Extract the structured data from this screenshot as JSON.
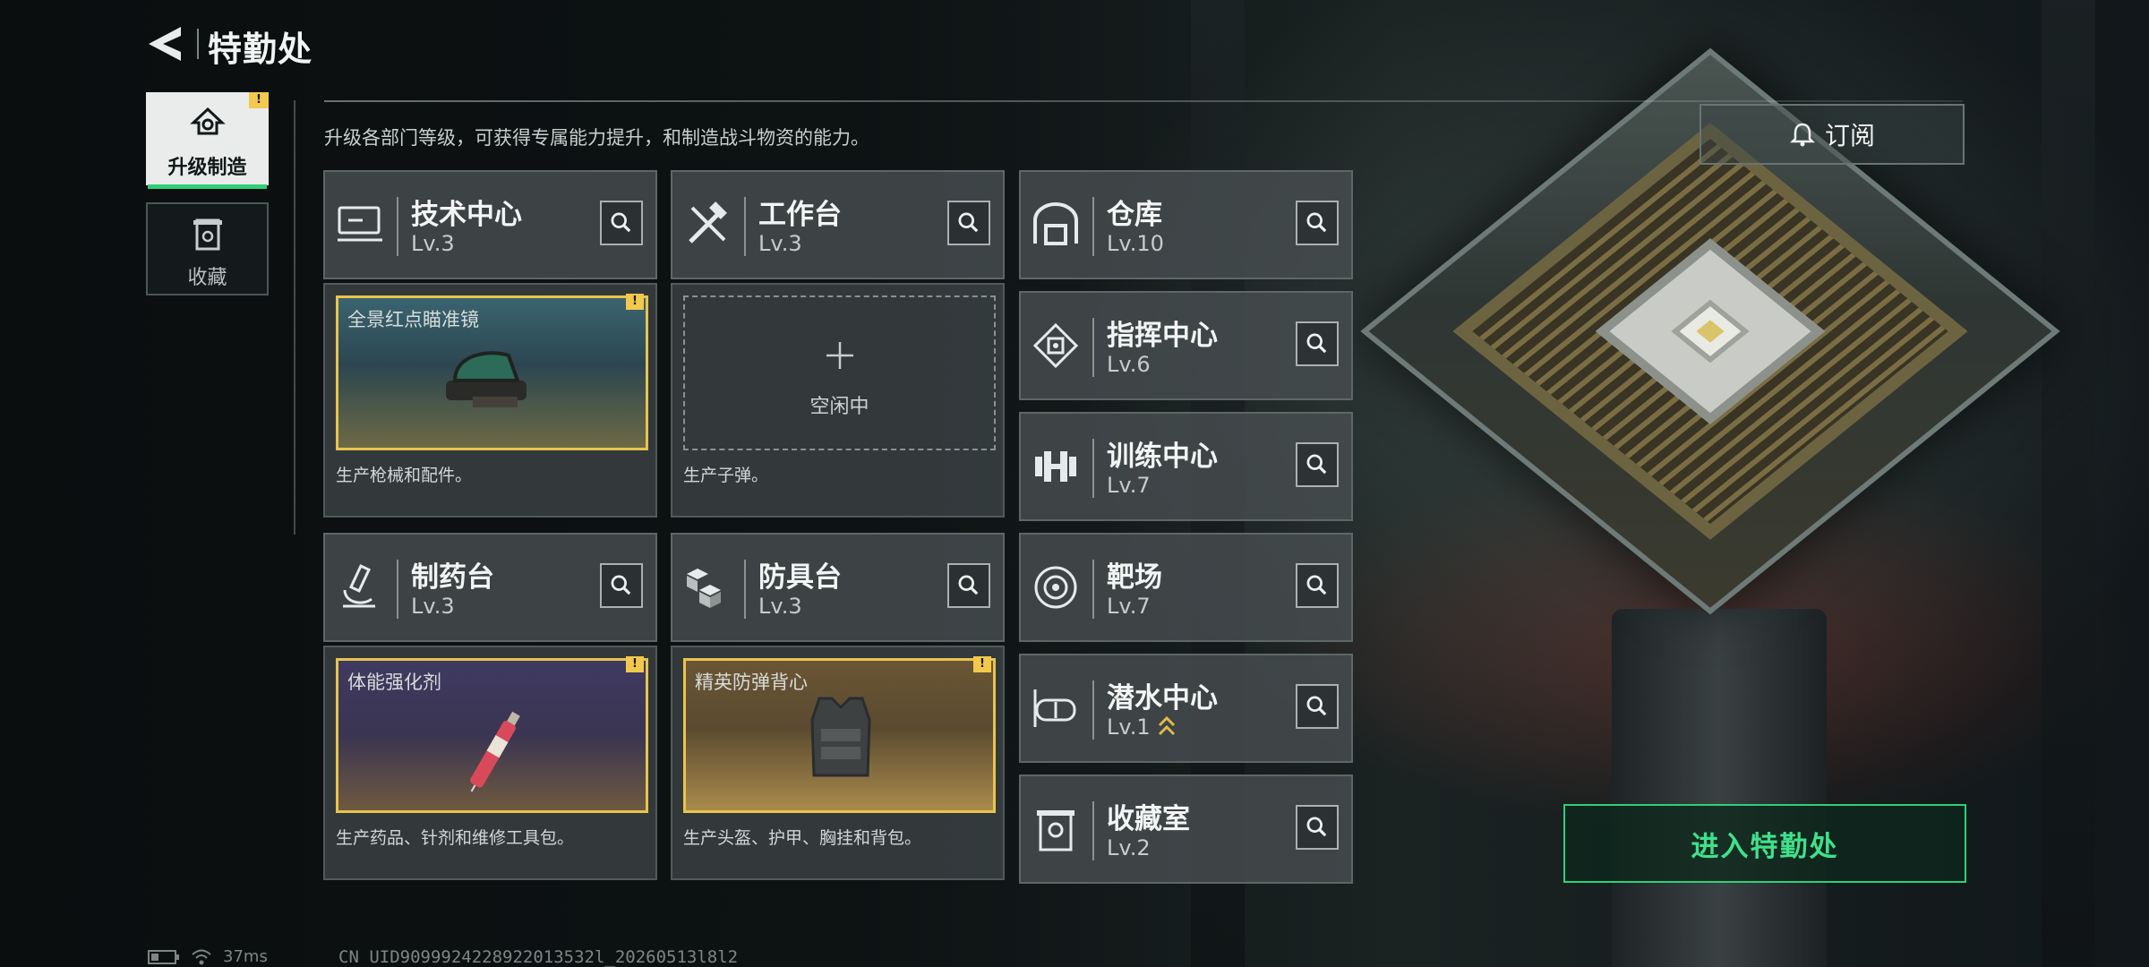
{
  "header": {
    "title": "特勤处"
  },
  "side_tabs": [
    {
      "label": "升级制造",
      "icon": "upgrade-icon",
      "badge": "!"
    },
    {
      "label": "收藏",
      "icon": "collection-icon"
    }
  ],
  "subtitle": "升级各部门等级，可获得专属能力提升，和制造战斗物资的能力。",
  "subscribe": {
    "label": "订阅",
    "icon": "bell-icon"
  },
  "departments": [
    {
      "name": "技术中心",
      "level": "Lv.3",
      "icon": "computer-icon"
    },
    {
      "name": "工作台",
      "level": "Lv.3",
      "icon": "tools-icon"
    },
    {
      "name": "制药台",
      "level": "Lv.3",
      "icon": "microscope-icon"
    },
    {
      "name": "防具台",
      "level": "Lv.3",
      "icon": "blocks-icon"
    },
    {
      "name": "仓库",
      "level": "Lv.10",
      "icon": "warehouse-icon"
    },
    {
      "name": "指挥中心",
      "level": "Lv.6",
      "icon": "chip-icon"
    },
    {
      "name": "训练中心",
      "level": "Lv.7",
      "icon": "dumbbell-icon"
    },
    {
      "name": "靶场",
      "level": "Lv.7",
      "icon": "target-icon"
    },
    {
      "name": "潜水中心",
      "level": "Lv.1",
      "icon": "goggles-icon",
      "upgradable": true
    },
    {
      "name": "收藏室",
      "level": "Lv.2",
      "icon": "trophy-icon"
    }
  ],
  "production": [
    {
      "item": "全景红点瞄准镜",
      "desc": "生产枪械和配件。",
      "badge": "!",
      "image": "scope",
      "tint": "#3a6470"
    },
    {
      "item": "",
      "empty_label": "空闲中",
      "desc": "生产子弹。",
      "image": "empty"
    },
    {
      "item": "体能强化剂",
      "desc": "生产药品、针剂和维修工具包。",
      "badge": "!",
      "image": "syringe",
      "tint": "#3f3a60"
    },
    {
      "item": "精英防弹背心",
      "desc": "生产头盔、护甲、胸挂和背包。",
      "badge": "!",
      "image": "vest",
      "tint": "#6a5634"
    }
  ],
  "enter_button": {
    "label": "进入特勤处",
    "color": "#3fe18b"
  },
  "status_bar": {
    "ping": "37ms",
    "uid": "CN UID9099924228922013532l_20260513l8l2"
  },
  "colors": {
    "accent_green": "#2fcf79",
    "badge_yellow": "#f2c94c",
    "slot_border": "#e8c44e"
  }
}
